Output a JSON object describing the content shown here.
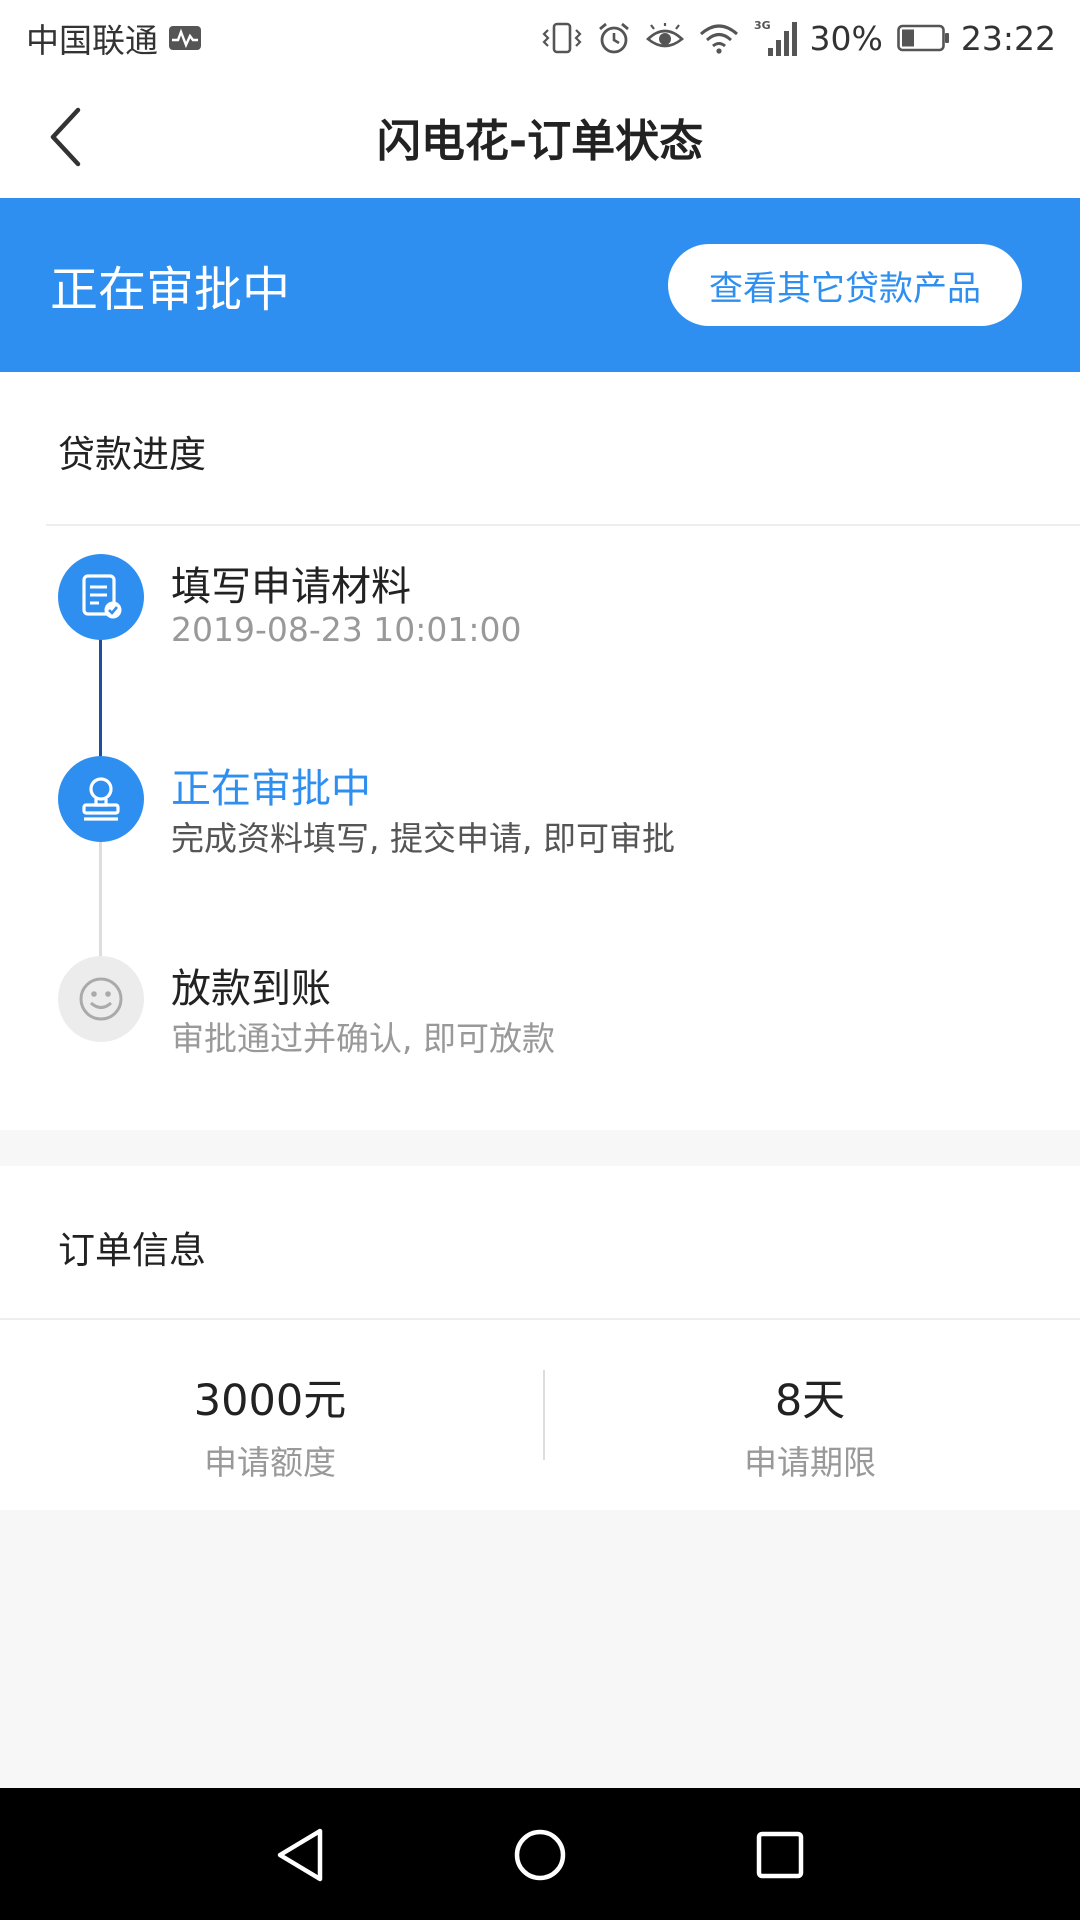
{
  "status_bar": {
    "carrier": "中国联通",
    "network_label": "3G",
    "battery": "30%",
    "time": "23:22",
    "icons": [
      "activity-monitor-icon",
      "vibrate-icon",
      "alarm-icon",
      "eye-icon",
      "wifi-icon",
      "signal-icon",
      "battery-icon"
    ]
  },
  "nav": {
    "title": "闪电花-订单状态",
    "back_icon": "chevron-left-icon"
  },
  "banner": {
    "status": "正在审批中",
    "other_products_button": "查看其它贷款产品",
    "color": "#2f8ff0"
  },
  "progress": {
    "title": "贷款进度",
    "steps": [
      {
        "icon": "document-check-icon",
        "title": "填写申请材料",
        "subtitle": "2019-08-23 10:01:00",
        "state": "done"
      },
      {
        "icon": "stamp-icon",
        "title": "正在审批中",
        "subtitle": "完成资料填写, 提交申请, 即可审批",
        "state": "current"
      },
      {
        "icon": "smiley-icon",
        "title": "放款到账",
        "subtitle": "审批通过并确认, 即可放款",
        "state": "pending"
      }
    ]
  },
  "order_info": {
    "title": "订单信息",
    "amount": {
      "value": "3000元",
      "label": "申请额度"
    },
    "term": {
      "value": "8天",
      "label": "申请期限"
    }
  },
  "android_nav": {
    "buttons": [
      "back-triangle-icon",
      "home-circle-icon",
      "recent-square-icon"
    ]
  }
}
